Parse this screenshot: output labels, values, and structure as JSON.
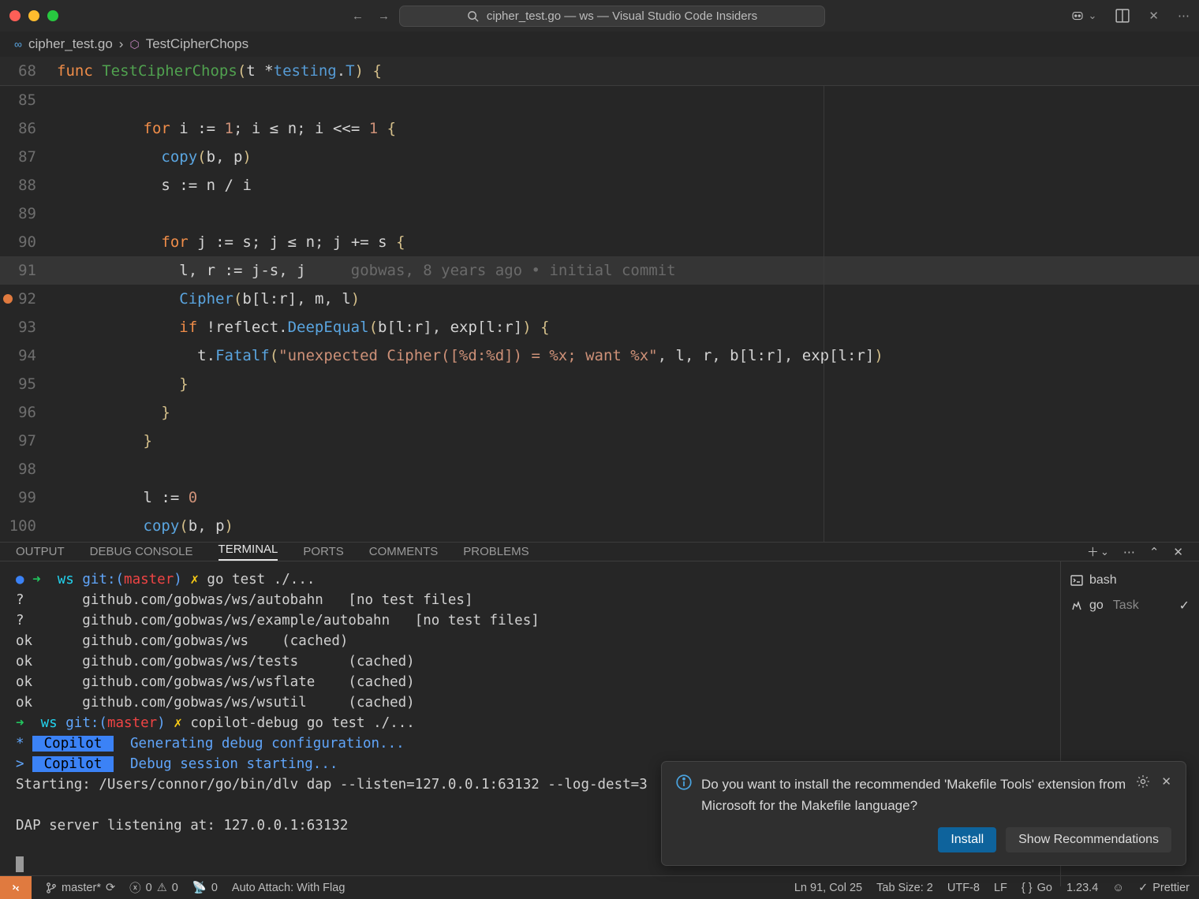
{
  "titlebar": {
    "title": "cipher_test.go — ws — Visual Studio Code Insiders"
  },
  "breadcrumb": {
    "file": "cipher_test.go",
    "symbol": "TestCipherChops"
  },
  "sticky": {
    "ln": "68",
    "code_html": "<span class='kw'>func</span> <span class='fn'>TestCipherChops</span><span class='paren'>(</span><span class='id'>t</span> <span class='op'>*</span><span class='ty'>testing</span>.<span class='ty'>T</span><span class='paren'>)</span> <span class='paren'>{</span>"
  },
  "code": [
    {
      "ln": "85",
      "indent": "        ",
      "html": ""
    },
    {
      "ln": "86",
      "indent": "        ",
      "html": "<span class='kw'>for</span> <span class='id'>i</span> <span class='op'>:=</span> <span class='num'>1</span>; <span class='id'>i</span> <span class='op'>≤</span> <span class='id'>n</span>; <span class='id'>i</span> <span class='op'>&lt;&lt;=</span> <span class='num'>1</span> <span class='paren'>{</span>"
    },
    {
      "ln": "87",
      "indent": "          ",
      "html": "<span class='call'>copy</span><span class='paren'>(</span><span class='id'>b</span>, <span class='id'>p</span><span class='paren'>)</span>"
    },
    {
      "ln": "88",
      "indent": "          ",
      "html": "<span class='id'>s</span> <span class='op'>:=</span> <span class='id'>n</span> <span class='op'>/</span> <span class='id'>i</span>"
    },
    {
      "ln": "89",
      "indent": "          ",
      "html": ""
    },
    {
      "ln": "90",
      "indent": "          ",
      "html": "<span class='kw'>for</span> <span class='id'>j</span> <span class='op'>:=</span> <span class='id'>s</span>; <span class='id'>j</span> <span class='op'>≤</span> <span class='id'>n</span>; <span class='id'>j</span> <span class='op'>+=</span> <span class='id'>s</span> <span class='paren'>{</span>"
    },
    {
      "ln": "91",
      "indent": "            ",
      "html": "<span class='id'>l</span>, <span class='id'>r</span> <span class='op'>:=</span> <span class='id'>j</span><span class='op'>-</span><span class='id'>s</span>, <span class='id'>j</span>     <span class='blame'>gobwas, 8 years ago • initial commit</span>",
      "current": true
    },
    {
      "ln": "92",
      "indent": "            ",
      "html": "<span class='call'>Cipher</span><span class='paren'>(</span><span class='id'>b</span>[<span class='id'>l</span>:<span class='id'>r</span>], <span class='id'>m</span>, <span class='id'>l</span><span class='paren'>)</span>",
      "bp": true
    },
    {
      "ln": "93",
      "indent": "            ",
      "html": "<span class='kw'>if</span> <span class='op'>!</span><span class='id'>reflect</span>.<span class='call'>DeepEqual</span><span class='paren'>(</span><span class='id'>b</span>[<span class='id'>l</span>:<span class='id'>r</span>], <span class='id'>exp</span>[<span class='id'>l</span>:<span class='id'>r</span>]<span class='paren'>)</span> <span class='paren'>{</span>"
    },
    {
      "ln": "94",
      "indent": "              ",
      "html": "<span class='id'>t</span>.<span class='call'>Fatalf</span><span class='paren'>(</span><span class='str'>\"unexpected Cipher([%d:%d]) = %x; want %x\"</span>, <span class='id'>l</span>, <span class='id'>r</span>, <span class='id'>b</span>[<span class='id'>l</span>:<span class='id'>r</span>], <span class='id'>exp</span>[<span class='id'>l</span>:<span class='id'>r</span>]<span class='paren'>)</span>"
    },
    {
      "ln": "95",
      "indent": "            ",
      "html": "<span class='paren'>}</span>"
    },
    {
      "ln": "96",
      "indent": "          ",
      "html": "<span class='paren'>}</span>"
    },
    {
      "ln": "97",
      "indent": "        ",
      "html": "<span class='paren'>}</span>"
    },
    {
      "ln": "98",
      "indent": "        ",
      "html": ""
    },
    {
      "ln": "99",
      "indent": "        ",
      "html": "<span class='id'>l</span> <span class='op'>:=</span> <span class='num'>0</span>"
    },
    {
      "ln": "100",
      "indent": "        ",
      "html": "<span class='call'>copy</span><span class='paren'>(</span><span class='id'>b</span>, <span class='id'>p</span><span class='paren'>)</span>"
    }
  ],
  "panel": {
    "tabs": [
      "OUTPUT",
      "DEBUG CONSOLE",
      "TERMINAL",
      "PORTS",
      "COMMENTS",
      "PROBLEMS"
    ],
    "active_tab": "TERMINAL",
    "terminals": [
      {
        "icon": "shell",
        "name": "bash"
      },
      {
        "icon": "tool",
        "name": "go",
        "task": "Task",
        "check": true
      }
    ],
    "terminal_lines_html": [
      "<span class='t-dot-blue'>●</span> <span class='t-arrow-green'>➜</span>  <span class='t-cyan'>ws</span> <span class='t-blue'>git:(</span><span class='t-red'>master</span><span class='t-blue'>)</span> <span class='t-yellow'>✗</span> go test ./...",
      "?       github.com/gobwas/ws/autobahn   [no test files]",
      "?       github.com/gobwas/ws/example/autobahn   [no test files]",
      "ok      github.com/gobwas/ws    (cached)",
      "ok      github.com/gobwas/ws/tests      (cached)",
      "ok      github.com/gobwas/ws/wsflate    (cached)",
      "ok      github.com/gobwas/ws/wsutil     (cached)",
      "<span class='t-arrow-green'>➜</span>  <span class='t-cyan'>ws</span> <span class='t-blue'>git:(</span><span class='t-red'>master</span><span class='t-blue'>)</span> <span class='t-yellow'>✗</span> copilot-debug go test ./...",
      "<span class='t-blue'>*</span> <span class='t-badge'> Copilot </span>  <span class='t-blue'>Generating debug configuration...</span>",
      "<span class='t-blue'>&gt;</span> <span class='t-badge'> Copilot </span>  <span class='t-blue'>Debug session starting...</span>",
      "Starting: /Users/connor/go/bin/dlv dap --listen=127.0.0.1:63132 --log-dest=3 ",
      "",
      "DAP server listening at: 127.0.0.1:63132",
      "",
      "<span class='t-cursor'></span>"
    ]
  },
  "notification": {
    "message": "Do you want to install the recommended 'Makefile Tools' extension from Microsoft for the Makefile language?",
    "primary": "Install",
    "secondary": "Show Recommendations"
  },
  "statusbar": {
    "branch": "master*",
    "errors": "0",
    "warnings": "0",
    "ports": "0",
    "autoattach": "Auto Attach: With Flag",
    "cursor": "Ln 91, Col 25",
    "tabsize": "Tab Size: 2",
    "encoding": "UTF-8",
    "eol": "LF",
    "lang": "Go",
    "gover": "1.23.4",
    "prettier": "Prettier"
  }
}
